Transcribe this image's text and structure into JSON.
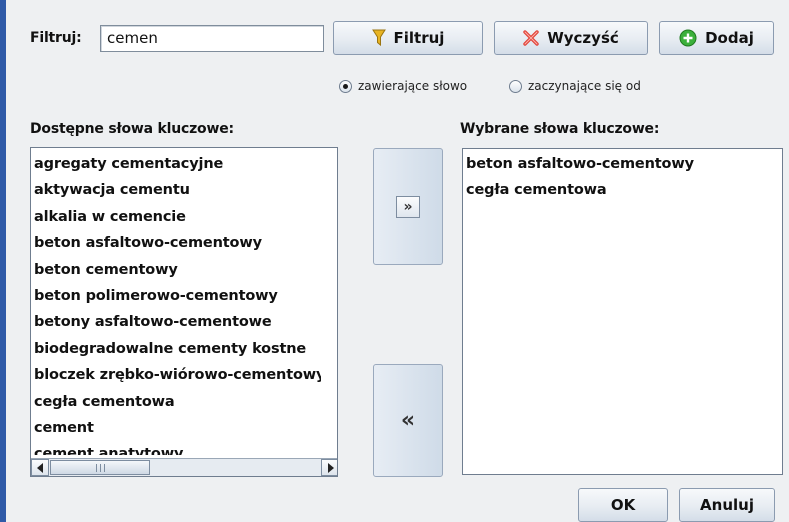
{
  "filter": {
    "label": "Filtruj:",
    "value": "cemen",
    "filter_button": "Filtruj",
    "clear_button": "Wyczyść",
    "add_button": "Dodaj"
  },
  "match_mode": {
    "option_contains": "zawierające słowo",
    "option_starts": "zaczynające się od",
    "selected": "zawierające słowo"
  },
  "available": {
    "label": "Dostępne słowa kluczowe:",
    "items": [
      "agregaty cementacyjne",
      "aktywacja cementu",
      "alkalia w cemencie",
      "beton asfaltowo-cementowy",
      "beton cementowy",
      "beton polimerowo-cementowy",
      "betony asfaltowo-cementowe",
      "biodegradowalne cementy kostne",
      "bloczek zrębko-wiórowo-cementowy",
      "cegła cementowa",
      "cement",
      "cement anatytowy"
    ]
  },
  "transfer": {
    "add_glyph": "»",
    "remove_glyph": "«"
  },
  "selected_list": {
    "label": "Wybrane słowa kluczowe:",
    "items": [
      "beton asfaltowo-cementowy",
      "cegła cementowa"
    ]
  },
  "footer": {
    "ok": "OK",
    "cancel": "Anuluj"
  },
  "colors": {
    "accent": "#2f5aa8",
    "background": "#eef0f2",
    "clear_icon": "#e0443a",
    "add_icon": "#3bb03b",
    "filter_icon": "#e8b422"
  }
}
